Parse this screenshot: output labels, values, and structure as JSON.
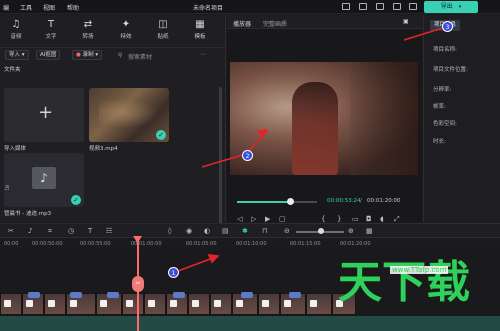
{
  "menu": {
    "items": [
      "编",
      "工具",
      "视图",
      "帮助"
    ],
    "project_title": "未命名项目",
    "export_label": "导出"
  },
  "tools": [
    {
      "label": "音频",
      "icon": "music-note-icon"
    },
    {
      "label": "文字",
      "icon": "text-t-icon"
    },
    {
      "label": "转场",
      "icon": "transition-icon"
    },
    {
      "label": "特效",
      "icon": "sparkle-icon"
    },
    {
      "label": "贴纸",
      "icon": "sticker-icon"
    },
    {
      "label": "模板",
      "icon": "template-icon"
    }
  ],
  "filterbar": {
    "import": "导入",
    "ai": "AI抠图",
    "record": "录制",
    "search_placeholder": "搜索素材"
  },
  "folder_label": "文件夹",
  "media": [
    {
      "label": "导入媒体",
      "kind": "import"
    },
    {
      "label": "视频3.mp4",
      "kind": "video"
    },
    {
      "label": "管晨书 - 迪迹.mp3",
      "kind": "audio"
    }
  ],
  "player": {
    "tab1": "播放器",
    "tab2": "完整画质",
    "current_time": "00:00:53:24",
    "total_time": "00:01:20:00",
    "progress": 0.66
  },
  "props": {
    "tab": "项目信息",
    "fields": [
      "项目名称:",
      "项目文件位置:",
      "分辨率:",
      "帧率:",
      "色彩空间:",
      "时长:"
    ]
  },
  "ruler": [
    "00:00",
    "00:00:50:00",
    "00:00:55:00",
    "00:01:00:00",
    "00:01:05:00",
    "00:01:10:00",
    "00:01:15:00",
    "00:01:20:00"
  ],
  "annotations": [
    "1",
    "2",
    "3"
  ],
  "watermark": {
    "text": "天下载",
    "url": "www.TTafp.com"
  }
}
